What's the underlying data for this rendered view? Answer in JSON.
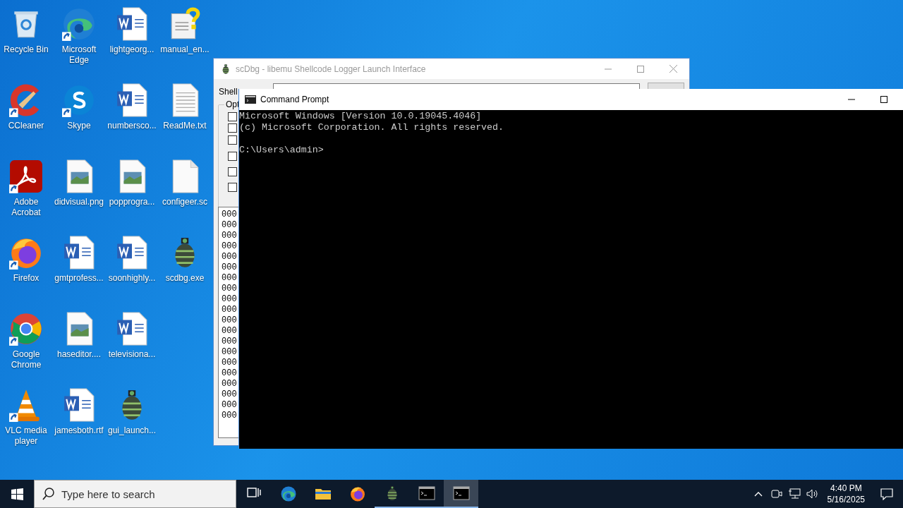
{
  "desktop_icons": [
    [
      {
        "label": "Recycle Bin",
        "kind": "recycle",
        "shortcut": false
      },
      {
        "label": "CCleaner",
        "kind": "ccleaner",
        "shortcut": true
      },
      {
        "label": "Adobe Acrobat",
        "kind": "acrobat",
        "shortcut": true
      },
      {
        "label": "Firefox",
        "kind": "firefox",
        "shortcut": true
      },
      {
        "label": "Google Chrome",
        "kind": "chrome",
        "shortcut": true
      },
      {
        "label": "VLC media player",
        "kind": "vlc",
        "shortcut": true
      }
    ],
    [
      {
        "label": "Microsoft Edge",
        "kind": "edge",
        "shortcut": true
      },
      {
        "label": "Skype",
        "kind": "skype",
        "shortcut": true
      },
      {
        "label": "didvisual.png",
        "kind": "image",
        "shortcut": false
      },
      {
        "label": "gmtprofess...",
        "kind": "word",
        "shortcut": false
      },
      {
        "label": "haseditor....",
        "kind": "image",
        "shortcut": false
      },
      {
        "label": "jamesboth.rtf",
        "kind": "word",
        "shortcut": false
      }
    ],
    [
      {
        "label": "lightgeorg...",
        "kind": "word",
        "shortcut": false
      },
      {
        "label": "numbersco...",
        "kind": "word",
        "shortcut": false
      },
      {
        "label": "popprogra...",
        "kind": "image",
        "shortcut": false
      },
      {
        "label": "soonhighly...",
        "kind": "word",
        "shortcut": false
      },
      {
        "label": "televisiona...",
        "kind": "word",
        "shortcut": false
      },
      {
        "label": "gui_launch...",
        "kind": "exe",
        "shortcut": false
      }
    ],
    [
      {
        "label": "manual_en...",
        "kind": "help",
        "shortcut": false
      },
      {
        "label": "ReadMe.txt",
        "kind": "text",
        "shortcut": false
      },
      {
        "label": "configeer.sc",
        "kind": "blank",
        "shortcut": false
      },
      {
        "label": "scdbg.exe",
        "kind": "exe",
        "shortcut": false
      }
    ]
  ],
  "scdbg_window": {
    "title": "scDbg - libemu Shellcode Logger Launch Interface",
    "file_label": "Shell",
    "options_label": "Opt",
    "options": [
      {
        "checked": false
      },
      {
        "checked": false
      },
      {
        "checked": false
      },
      {
        "checked": false
      },
      {
        "checked": false
      },
      {
        "checked": false
      }
    ],
    "log_lines": [
      "000",
      "000",
      "000",
      "000",
      "000",
      "000",
      "000",
      "000",
      "000",
      "000",
      "000",
      "000",
      "000",
      "000",
      "000",
      "000",
      "000",
      "000",
      "000",
      "000"
    ]
  },
  "cmd_window": {
    "title": "Command Prompt",
    "output": [
      "Microsoft Windows [Version 10.0.19045.4046]",
      "(c) Microsoft Corporation. All rights reserved."
    ],
    "prompt": "C:\\Users\\admin>"
  },
  "taskbar": {
    "search": {
      "placeholder": "Type here to search"
    },
    "apps": [
      {
        "kind": "taskview",
        "running": false,
        "active": false
      },
      {
        "kind": "edge",
        "running": false,
        "active": false
      },
      {
        "kind": "explorer",
        "running": false,
        "active": false
      },
      {
        "kind": "firefox",
        "running": false,
        "active": false
      },
      {
        "kind": "exe",
        "running": true,
        "active": false
      },
      {
        "kind": "cmd",
        "running": true,
        "active": false
      },
      {
        "kind": "cmd",
        "running": true,
        "active": true
      }
    ],
    "time": "4:40 PM",
    "date": "5/16/2025"
  }
}
